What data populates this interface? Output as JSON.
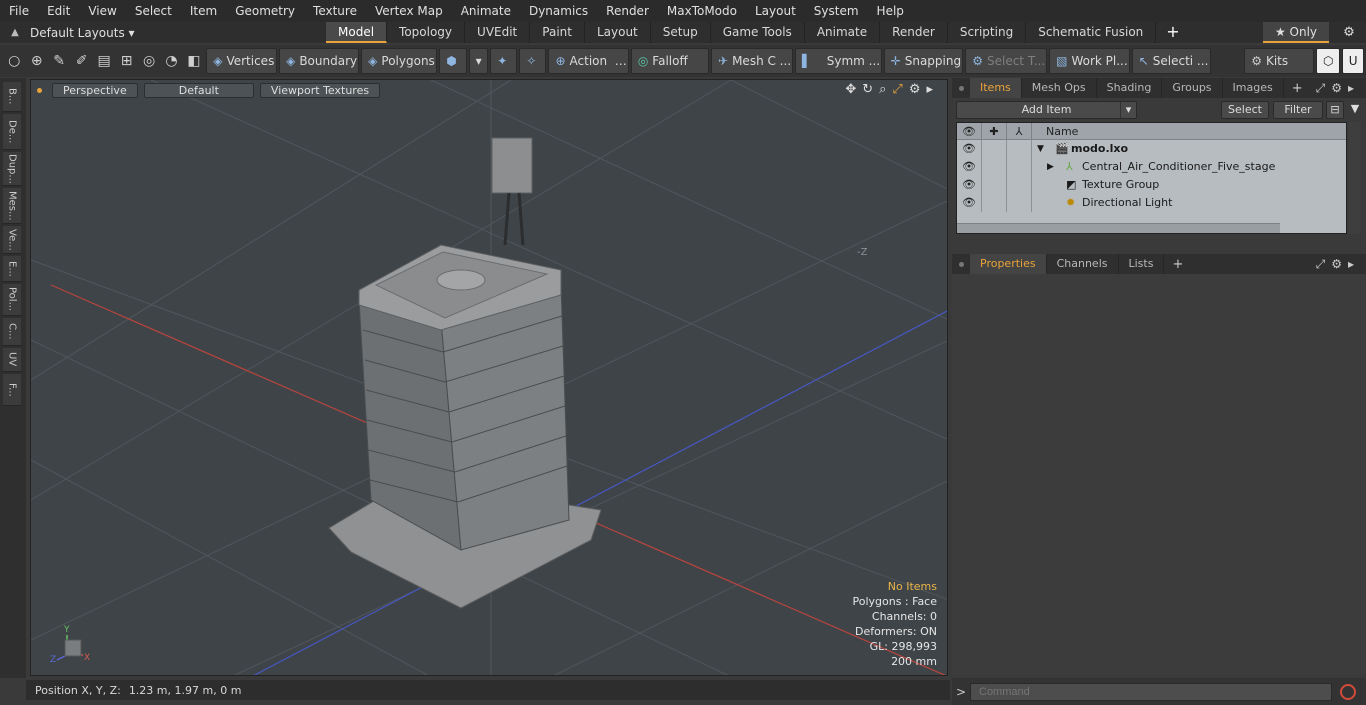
{
  "menu": [
    "File",
    "Edit",
    "View",
    "Select",
    "Item",
    "Geometry",
    "Texture",
    "Vertex Map",
    "Animate",
    "Dynamics",
    "Render",
    "MaxToModo",
    "Layout",
    "System",
    "Help"
  ],
  "layout": {
    "default_layouts": "Default Layouts ▾",
    "tabs": [
      "Model",
      "Topology",
      "UVEdit",
      "Paint",
      "Layout",
      "Setup",
      "Game Tools",
      "Animate",
      "Render",
      "Scripting",
      "Schematic Fusion"
    ],
    "active_tab": "Model",
    "only_label": "★  Only"
  },
  "toolbar": {
    "vertices": "Vertices",
    "boundary": "Boundary",
    "polygons": "Polygons",
    "action": "Action",
    "falloff": "Falloff",
    "mesh": "Mesh C ...",
    "symm": "Symm ...",
    "snapping": "Snapping",
    "select_t": "Select T...",
    "work_pl": "Work Pl...",
    "selecti": "Selecti ...",
    "kits": "Kits"
  },
  "left_tabs": [
    "B...",
    "De...",
    "Dup...",
    "Mes...",
    "Ve...",
    "E...",
    "Pol...",
    "C...",
    "UV",
    "F..."
  ],
  "viewport": {
    "perspective": "Perspective",
    "default": "Default",
    "textures": "Viewport Textures",
    "axis_neg_z": "-Z",
    "info": {
      "no_items": "No Items",
      "polygons": "Polygons : Face",
      "channels": "Channels: 0",
      "deformers": "Deformers: ON",
      "gl": "GL: 298,993",
      "unit": "200 mm"
    },
    "axes": {
      "x": "X",
      "y": "Y",
      "z": "Z"
    }
  },
  "status": {
    "label": "Position X, Y, Z:",
    "value": "1.23 m, 1.97 m, 0 m"
  },
  "items_panel": {
    "tabs": [
      "Items",
      "Mesh Ops",
      "Shading",
      "Groups",
      "Images"
    ],
    "active": "Items",
    "add_item": "Add Item",
    "select": "Select",
    "filter": "Filter",
    "column_name": "Name",
    "rows": [
      {
        "name": "modo.lxo",
        "level": 0
      },
      {
        "name": "Central_Air_Conditioner_Five_stage",
        "level": 1
      },
      {
        "name": "Texture Group",
        "level": 1
      },
      {
        "name": "Directional Light",
        "level": 1
      }
    ]
  },
  "props_panel": {
    "tabs": [
      "Properties",
      "Channels",
      "Lists"
    ],
    "active": "Properties"
  },
  "command": {
    "placeholder": "Command",
    "prompt": ">"
  },
  "colors": {
    "accent": "#e8a33a",
    "viewport_bg": "#3f4448",
    "grid_x": "#c0463f",
    "grid_z": "#4a5cc6"
  }
}
